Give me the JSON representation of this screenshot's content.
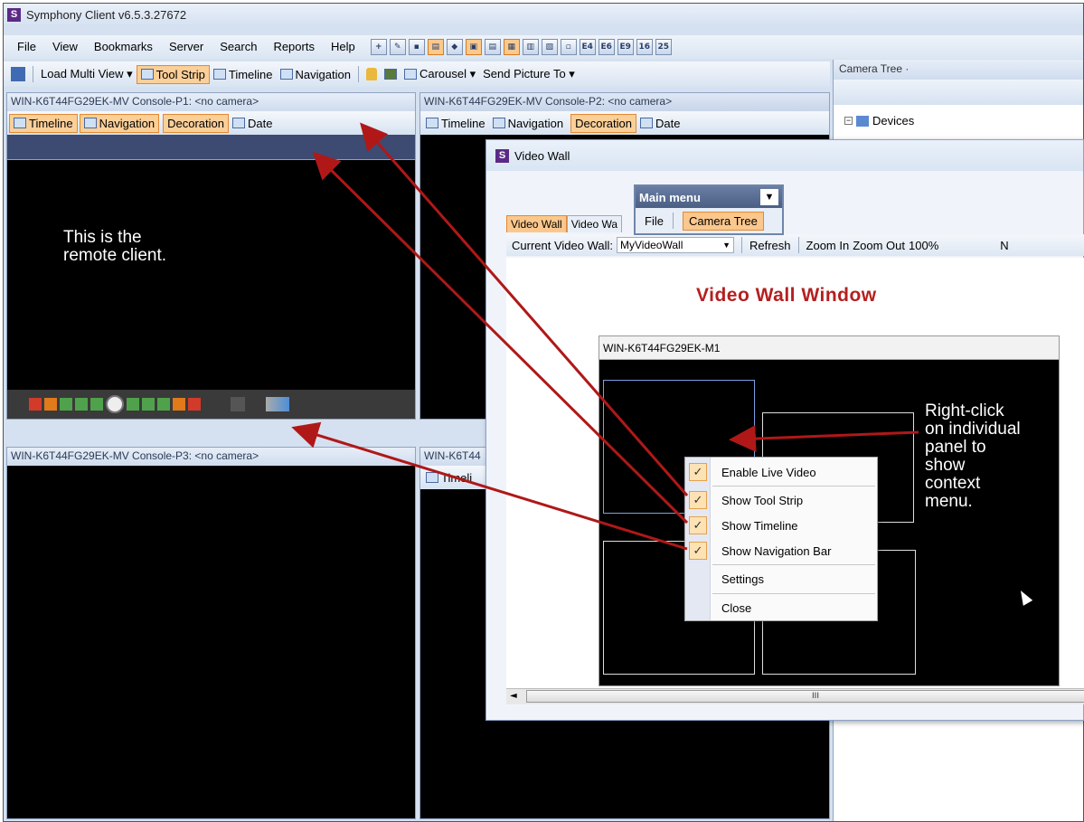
{
  "app": {
    "title": "Symphony Client v6.5.3.27672",
    "logo_letter": "S"
  },
  "menubar": {
    "items": [
      "File",
      "View",
      "Bookmarks",
      "Server",
      "Search",
      "Reports",
      "Help"
    ],
    "icons": [
      "add-icon",
      "edit-icon",
      "layout1-icon",
      "layout2-icon",
      "diamond-icon",
      "layout3-icon",
      "layout4-icon",
      "layout5-icon",
      "layout6-icon",
      "grid-icon",
      "layout7-icon",
      "layout8-icon",
      "layout9-icon",
      "layout10-icon",
      "layout16-icon",
      "layout25-icon"
    ],
    "icon_labels": [
      "+",
      "✎",
      "▪",
      "▤",
      "◆",
      "▣",
      "▤",
      "▦",
      "▥",
      "▧",
      "▫",
      "E4",
      "E6",
      "E9",
      "16",
      "25"
    ]
  },
  "toolbar2": {
    "save_label": "",
    "load_multi_view": "Load Multi View ▾",
    "tool_strip": "Tool Strip",
    "timeline": "Timeline",
    "navigation": "Navigation",
    "carousel": "Carousel ▾",
    "send_picture": "Send Picture To ▾"
  },
  "panels": {
    "p1": {
      "title": "WIN-K6T44FG29EK-MV Console-P1: <no camera>"
    },
    "p2": {
      "title": "WIN-K6T44FG29EK-MV Console-P2: <no camera>"
    },
    "p3": {
      "title": "WIN-K6T44FG29EK-MV Console-P3: <no camera>"
    },
    "p4": {
      "title": "WIN-K6T44"
    },
    "strip": {
      "timeline": "Timeline",
      "navigation": "Navigation",
      "decoration": "Decoration",
      "date": "Date"
    },
    "p4_strip_label": "Timeli"
  },
  "annotations": {
    "remote_client": "This is the\nremote client.",
    "right_click": "Right-click\non individual\npanel to\nshow\ncontext\nmenu."
  },
  "camera_tree": {
    "header": "Camera Tree ·",
    "root": "Devices"
  },
  "video_wall": {
    "title": "Video Wall",
    "main_menu": "Main menu",
    "main_menu_items": [
      "File",
      "Camera Tree"
    ],
    "tabs": [
      "Video Wall",
      "Video Wa"
    ],
    "current_label": "Current Video Wall:",
    "current_value": "MyVideoWall",
    "actions": [
      "Refresh",
      "Zoom In",
      "Zoom Out",
      "100%"
    ],
    "trailing": "N",
    "heading": "Video Wall Window",
    "wall_name": "WIN-K6T44FG29EK-M1",
    "scroll_thumb": "III",
    "heading_color": "#b51f1f"
  },
  "context_menu": {
    "items": [
      {
        "label": "Enable Live Video",
        "checked": true
      },
      {
        "label": "Show Tool Strip",
        "checked": true
      },
      {
        "label": "Show Timeline",
        "checked": true
      },
      {
        "label": "Show Navigation Bar",
        "checked": true
      },
      {
        "label": "Settings",
        "checked": false
      },
      {
        "label": "Close",
        "checked": false
      }
    ]
  },
  "colors": {
    "highlight": "#fbcf98",
    "arrow": "#b01818",
    "brand": "#5b2a86"
  }
}
